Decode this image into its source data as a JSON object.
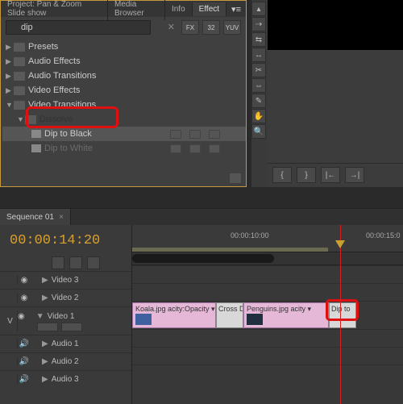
{
  "tabs": {
    "project": "Project: Pan & Zoom Slide show",
    "media": "Media Browser",
    "info": "Info",
    "effects": "Effect"
  },
  "search": {
    "placeholder": "",
    "value": "dip"
  },
  "mode_buttons": [
    "FX",
    "32",
    "YUV"
  ],
  "tree": {
    "presets": "Presets",
    "audio_effects": "Audio Effects",
    "audio_transitions": "Audio Transitions",
    "video_effects": "Video Effects",
    "video_transitions": "Video Transitions",
    "dissolve": "Dissolve",
    "dip_black": "Dip to Black",
    "dip_white": "Dip to White"
  },
  "sequence": {
    "tab": "Sequence 01",
    "timecode": "00:00:14:20",
    "ruler": [
      "00:00:10:00",
      "00:00:15:0"
    ],
    "tracks": {
      "v": "V",
      "v3": "Video 3",
      "v2": "Video 2",
      "v1": "Video 1",
      "a1": "Audio 1",
      "a2": "Audio 2",
      "a3": "Audio 3"
    },
    "clips": {
      "koala": "Koala.jpg  acity:Opacity ▾",
      "cross": "Cross D",
      "penguins": "Penguins.jpg  acity ▾",
      "dip": "Dip to"
    }
  }
}
